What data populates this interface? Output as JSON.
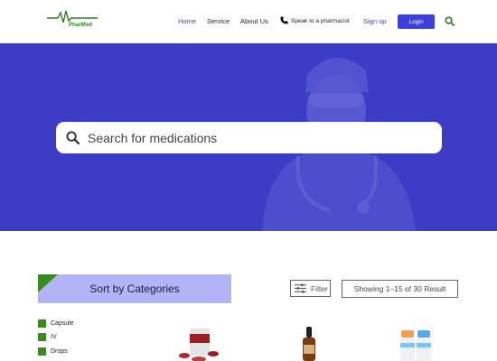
{
  "brand": {
    "name": "PharMed",
    "color": "#2f7d1f"
  },
  "nav": {
    "home": "Home",
    "service": "Service",
    "about": "About Us",
    "pharmacist": "Speak to a pharmacist",
    "signup": "Sign up",
    "login": "Login",
    "accent": "#3c3fd8"
  },
  "hero": {
    "background": "#3c3cc6",
    "search_placeholder": "Search for medications"
  },
  "categories": {
    "title": "Sort by Categories",
    "items": [
      {
        "label": "Capsule"
      },
      {
        "label": "IV"
      },
      {
        "label": "Drops"
      }
    ]
  },
  "toolbar": {
    "filter_label": "Filter",
    "results": "Showing 1–15 of 30 Result"
  },
  "products": [
    {
      "icon": "pill-box-product-image"
    },
    {
      "icon": "dropper-bottle-product-image"
    },
    {
      "icon": "pill-bottles-product-image"
    }
  ]
}
